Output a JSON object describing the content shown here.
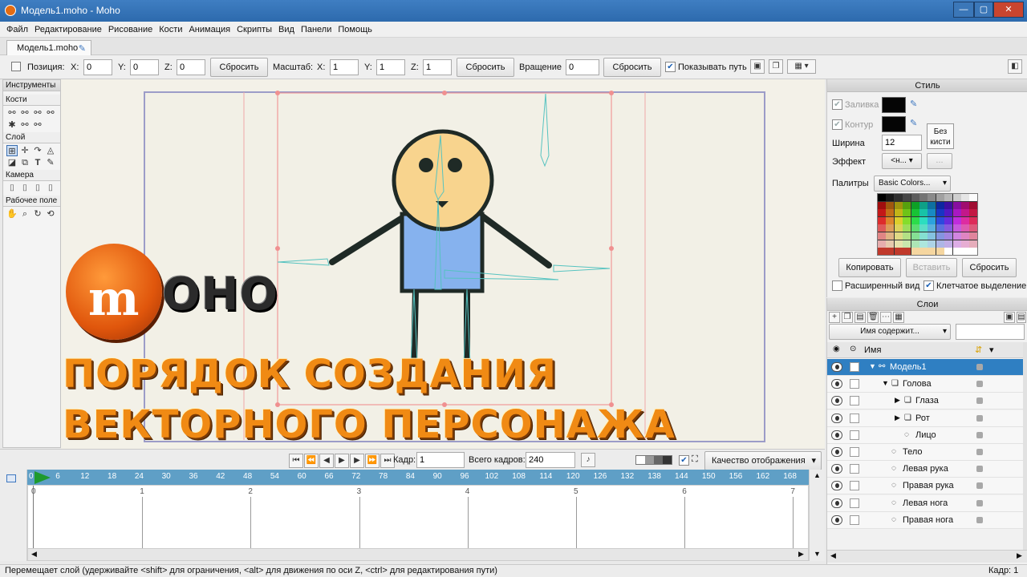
{
  "window": {
    "title": "Модель1.moho - Moho"
  },
  "menu": [
    "Файл",
    "Редактирование",
    "Рисование",
    "Кости",
    "Анимация",
    "Скрипты",
    "Вид",
    "Панели",
    "Помощь"
  ],
  "document_tab": "Модель1.moho",
  "toolbar": {
    "position_label": "Позиция:",
    "x_label": "X:",
    "x_value": "0",
    "y_label": "Y:",
    "y_value": "0",
    "z_label": "Z:",
    "z_value": "0",
    "reset1": "Сбросить",
    "scale_label": "Масштаб:",
    "sx_label": "X:",
    "sx_value": "1",
    "sy_label": "Y:",
    "sy_value": "1",
    "sz_label": "Z:",
    "sz_value": "1",
    "reset2": "Сбросить",
    "rotation_label": "Вращение",
    "rotation_value": "0",
    "reset3": "Сбросить",
    "show_path": "Показывать путь"
  },
  "tools": {
    "title": "Инструменты",
    "groups": [
      "Кости",
      "Слой",
      "Камера",
      "Рабочее поле"
    ]
  },
  "overlay": {
    "logo_text": "OHO",
    "line1": "ПОРЯДОК СОЗДАНИЯ",
    "line2": "ВЕКТОРНОГО ПЕРСОНАЖА"
  },
  "timeline": {
    "frame_label": "Кадр:",
    "frame_value": "1",
    "total_label": "Всего кадров:",
    "total_value": "240",
    "quality": "Качество отображения",
    "ruler_start": "0",
    "ruler": [
      "6",
      "12",
      "18",
      "24",
      "30",
      "36",
      "42",
      "48",
      "54",
      "60",
      "66",
      "72",
      "78",
      "84",
      "90",
      "96",
      "102",
      "108",
      "114",
      "120",
      "126",
      "132",
      "138",
      "144",
      "150",
      "156",
      "162",
      "168"
    ],
    "seconds": [
      "0",
      "1",
      "2",
      "3",
      "4",
      "5",
      "6",
      "7"
    ]
  },
  "style": {
    "title": "Стиль",
    "fill_label": "Заливка",
    "stroke_label": "Контур",
    "width_label": "Ширина",
    "width_value": "12",
    "no_brush": "Без кисти",
    "effect_label": "Эффект",
    "effect_value": "<н...",
    "effect_more": "...",
    "palettes_label": "Палитры",
    "palette_value": "Basic Colors...",
    "copy": "Копировать",
    "paste": "Вставить",
    "reset": "Сбросить",
    "advanced": "Расширенный вид",
    "cell_select": "Клетчатое выделение"
  },
  "layers": {
    "title": "Слои",
    "filter": "Имя содержит...",
    "name_header": "Имя",
    "items": [
      {
        "name": "Модель1",
        "indent": 0,
        "selected": true,
        "arrow": "▼"
      },
      {
        "name": "Голова",
        "indent": 1,
        "selected": false,
        "arrow": "▼"
      },
      {
        "name": "Глаза",
        "indent": 2,
        "selected": false,
        "arrow": "▶"
      },
      {
        "name": "Рот",
        "indent": 2,
        "selected": false,
        "arrow": "▶"
      },
      {
        "name": "Лицо",
        "indent": 2,
        "selected": false,
        "arrow": ""
      },
      {
        "name": "Тело",
        "indent": 1,
        "selected": false,
        "arrow": ""
      },
      {
        "name": "Левая рука",
        "indent": 1,
        "selected": false,
        "arrow": ""
      },
      {
        "name": "Правая рука",
        "indent": 1,
        "selected": false,
        "arrow": ""
      },
      {
        "name": "Левая нога",
        "indent": 1,
        "selected": false,
        "arrow": ""
      },
      {
        "name": "Правая нога",
        "indent": 1,
        "selected": false,
        "arrow": ""
      }
    ]
  },
  "status": {
    "hint": "Перемещает слой (удерживайте <shift> для ограничения, <alt> для движения по оси Z, <ctrl> для редактирования пути)",
    "frame": "Кадр: 1"
  },
  "colors": {
    "accent": "#2f7fc2",
    "ruler": "#5f9fc6",
    "promo": "#f08a14",
    "body_fill": "#86b2ee",
    "head_fill": "#f8d48e"
  }
}
